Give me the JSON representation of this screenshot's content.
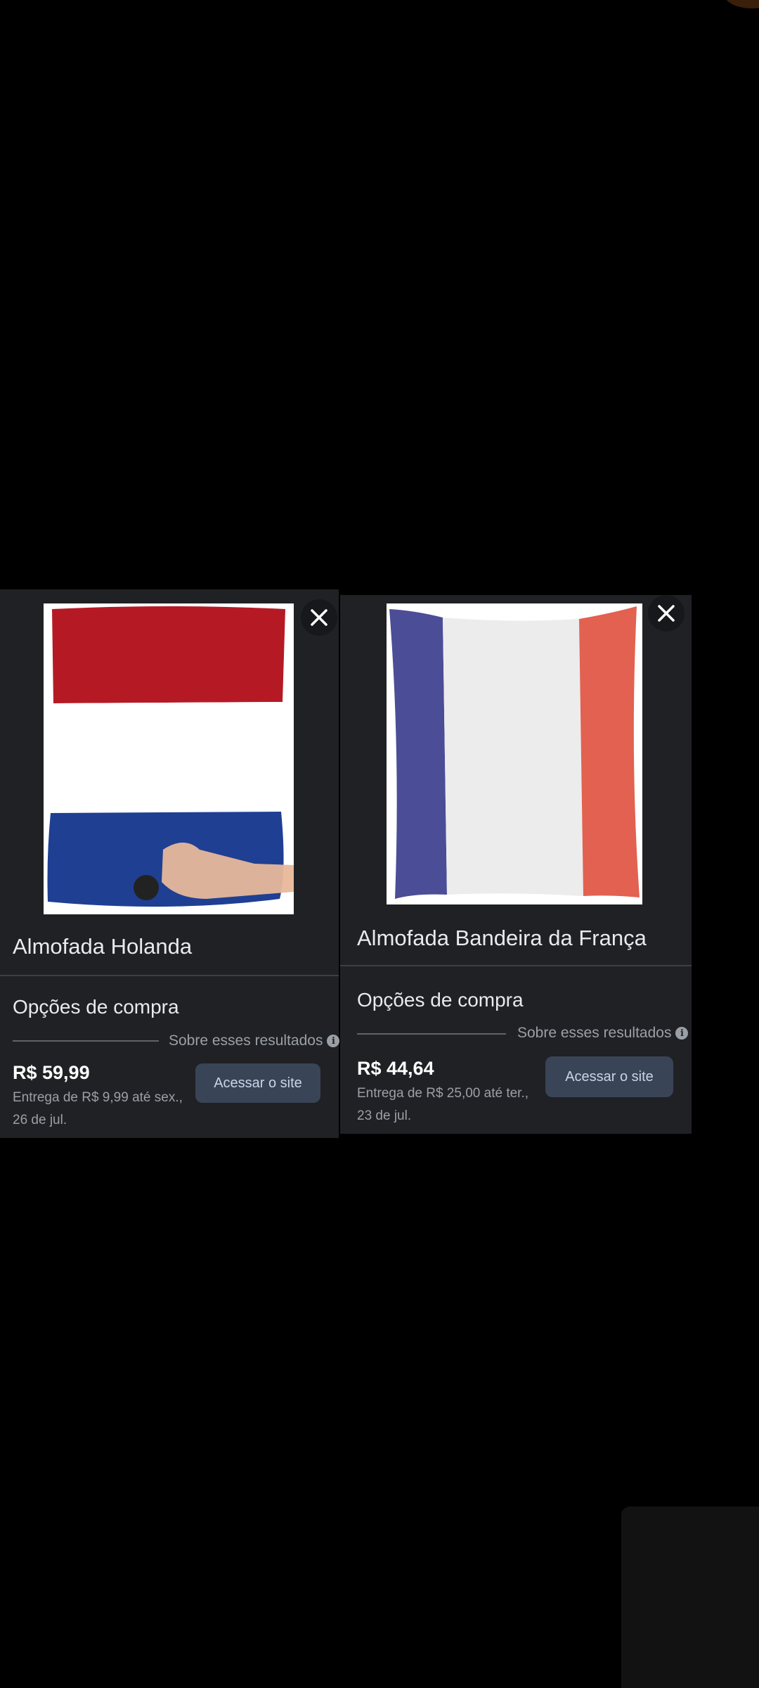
{
  "products": [
    {
      "title": "Almofada Holanda",
      "image_alt": "Almofada com bandeira da Holanda",
      "flag_colors": [
        "#b51a24",
        "#ffffff",
        "#1f3f93"
      ],
      "options_heading": "Opções de compra",
      "about_text": "Sobre esses resultados",
      "price": "R$ 59,99",
      "delivery": "Entrega de R$ 9,99 até sex., 26 de jul.",
      "button_label": "Acessar o site"
    },
    {
      "title": "Almofada Bandeira da França",
      "image_alt": "Almofada com bandeira da França",
      "flag_colors": [
        "#4b4d96",
        "#ececec",
        "#e26150"
      ],
      "options_heading": "Opções de compra",
      "about_text": "Sobre esses resultados",
      "price": "R$ 44,64",
      "delivery": "Entrega de R$ 25,00 até ter., 23 de jul.",
      "button_label": "Acessar o site"
    }
  ],
  "icons": {
    "close": "close-icon",
    "info": "info-icon"
  },
  "colors": {
    "card_background": "#202124",
    "button_background": "#394457",
    "page_background": "#000000"
  }
}
